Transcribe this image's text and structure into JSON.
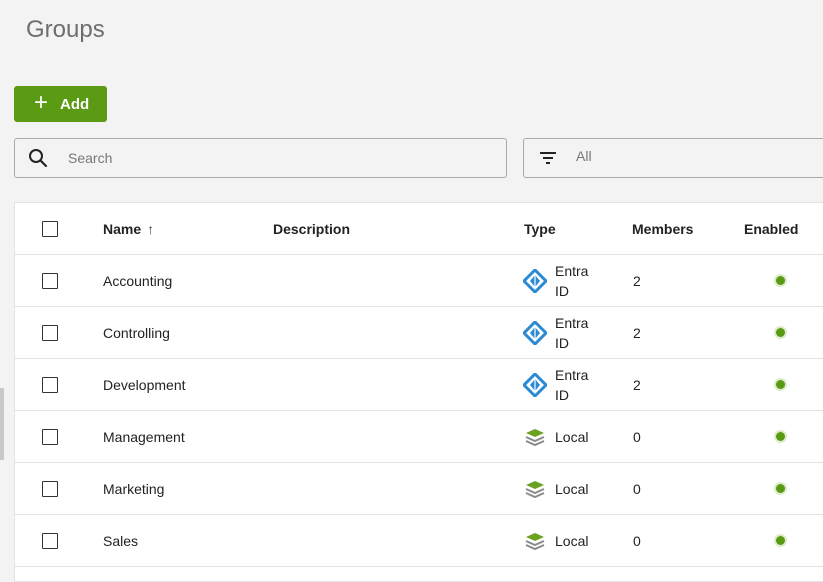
{
  "page": {
    "title": "Groups"
  },
  "toolbar": {
    "add_label": "Add"
  },
  "search": {
    "placeholder": "Search",
    "value": ""
  },
  "filter": {
    "value": "All"
  },
  "table": {
    "columns": {
      "name": "Name",
      "description": "Description",
      "type": "Type",
      "members": "Members",
      "enabled": "Enabled"
    },
    "sort": {
      "column": "name",
      "direction": "ascending",
      "icon": "arrow-up-icon"
    },
    "rows": [
      {
        "name": "Accounting",
        "description": "",
        "type_line1": "Entra",
        "type_line2": "ID",
        "type_icon": "entra-id-icon",
        "members": "2",
        "enabled": true
      },
      {
        "name": "Controlling",
        "description": "",
        "type_line1": "Entra",
        "type_line2": "ID",
        "type_icon": "entra-id-icon",
        "members": "2",
        "enabled": true
      },
      {
        "name": "Development",
        "description": "",
        "type_line1": "Entra",
        "type_line2": "ID",
        "type_icon": "entra-id-icon",
        "members": "2",
        "enabled": true
      },
      {
        "name": "Management",
        "description": "",
        "type_line1": "Local",
        "type_line2": "",
        "type_icon": "local-stack-icon",
        "members": "0",
        "enabled": true
      },
      {
        "name": "Marketing",
        "description": "",
        "type_line1": "Local",
        "type_line2": "",
        "type_icon": "local-stack-icon",
        "members": "0",
        "enabled": true
      },
      {
        "name": "Sales",
        "description": "",
        "type_line1": "Local",
        "type_line2": "",
        "type_icon": "local-stack-icon",
        "members": "0",
        "enabled": true
      }
    ]
  },
  "colors": {
    "accent": "#5b9a13",
    "entra_blue": "#2a8ad4",
    "local_green": "#6aa121",
    "enabled_dot": "#5b9a13"
  }
}
